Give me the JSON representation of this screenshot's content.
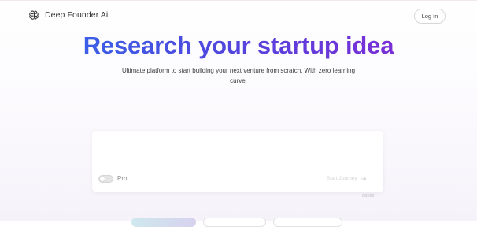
{
  "header": {
    "brand_name": "Deep Founder Ai",
    "brand_icon": "brain-icon",
    "login_label": "Log In"
  },
  "hero": {
    "title": "Research your startup idea",
    "subtitle": "Ultimate platform to start building your next venture from scratch. With zero learning curve."
  },
  "input": {
    "pro_label": "Pro",
    "pro_enabled": false,
    "start_label": "Start Journey",
    "start_icon": "arrow-right-icon",
    "char_count": "0/2000"
  },
  "colors": {
    "gradient_start": "#3b5fe6",
    "gradient_end": "#7a2fd6"
  }
}
